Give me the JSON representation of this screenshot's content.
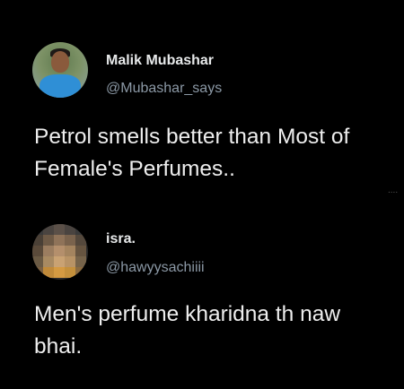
{
  "tweets": [
    {
      "author_name": "Malik Mubashar",
      "author_handle": "@Mubashar_says",
      "text_lines": [
        "Petrol smells better than Most of",
        "Female's Perfumes.."
      ],
      "more_indicator": "...."
    },
    {
      "author_name": "isra.",
      "author_handle": "@hawyysachiiii",
      "text_lines": [
        "Men's perfume kharidna th naw",
        "bhai."
      ]
    }
  ],
  "colors": {
    "background": "#000000",
    "name_text": "#e7e9ea",
    "handle_text": "#8b98a5",
    "body_text": "#eeeeee"
  },
  "icons": {
    "avatar_1": "user-avatar-photo",
    "avatar_2": "pixelated-avatar"
  }
}
